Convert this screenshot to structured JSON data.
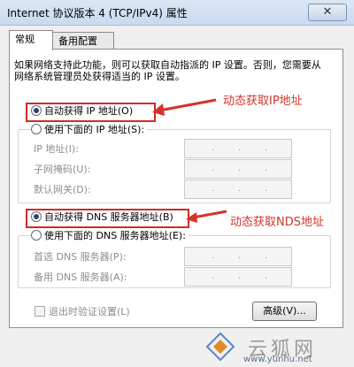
{
  "window": {
    "title": "Internet 协议版本 4 (TCP/IPv4) 属性",
    "close_glyph": "✕"
  },
  "tabs": [
    {
      "label": "常规"
    },
    {
      "label": "备用配置"
    }
  ],
  "description": "如果网络支持此功能，则可以获取自动指派的 IP 设置。否则，您需要从网络系统管理员处获得适当的 IP 设置。",
  "ip_section": {
    "auto_option": "自动获得 IP 地址(O)",
    "manual_option": "使用下面的 IP 地址(S):",
    "fields": [
      {
        "label": "IP 地址(I):",
        "value": ". . ."
      },
      {
        "label": "子网掩码(U):",
        "value": ". . ."
      },
      {
        "label": "默认网关(D):",
        "value": ". . ."
      }
    ]
  },
  "dns_section": {
    "auto_option": "自动获得 DNS 服务器地址(B)",
    "manual_option": "使用下面的 DNS 服务器地址(E):",
    "fields": [
      {
        "label": "首选 DNS 服务器(P):",
        "value": ". . ."
      },
      {
        "label": "备用 DNS 服务器(A):",
        "value": ". . ."
      }
    ]
  },
  "validate_label": "退出时验证设置(L)",
  "advanced_button": "高级(V)...",
  "annotations": {
    "ip": "动态获取IP地址",
    "dns": "动态获取NDS地址",
    "color": "#d3342c"
  },
  "watermark": {
    "text": "云狐网",
    "url": "www.yunhu.net"
  }
}
